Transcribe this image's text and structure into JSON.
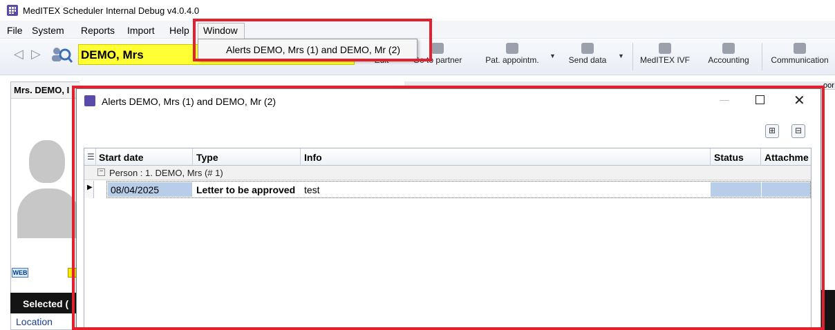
{
  "app": {
    "title": "MedITEX Scheduler Internal Debug v4.0.4.0"
  },
  "menu": {
    "items": [
      "File",
      "System",
      "Reports",
      "Import",
      "Help",
      "Window"
    ],
    "dropdown_item": "Alerts  DEMO, Mrs (1) and DEMO, Mr (2)"
  },
  "toolbar": {
    "patient_name": "DEMO, Mrs",
    "buttons": [
      "Edit",
      "Go to partner",
      "Pat. appointm.",
      "Send data",
      "MedITEX IVF",
      "Accounting",
      "Communication"
    ]
  },
  "left_panel": {
    "title": "Mrs. DEMO, I",
    "web_badge": "WEB",
    "selected": "Selected (",
    "location": "Location"
  },
  "right_bg_text": "oor",
  "dialog": {
    "title": "Alerts  DEMO, Mrs (1) and DEMO, Mr (2)",
    "expand_all": "⊞",
    "collapse_all": "⊟",
    "columns": [
      "Start date",
      "Type",
      "Info",
      "Status",
      "Attachme"
    ],
    "group_label": "Person : 1. DEMO, Mrs (# 1)",
    "rows": [
      {
        "start_date": "08/04/2025",
        "type": "Letter to be approved",
        "info": "test",
        "status": "",
        "attachment": ""
      }
    ]
  },
  "colors": {
    "highlight_red": "#e3202e",
    "patient_yellow": "#ffff33",
    "selection_blue": "#b8cde8"
  }
}
